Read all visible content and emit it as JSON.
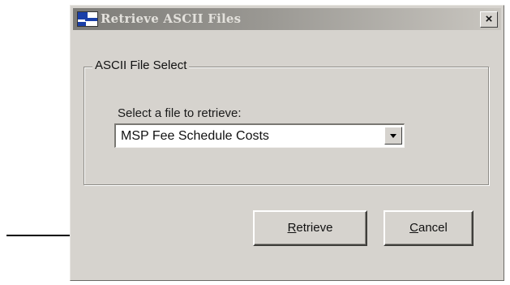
{
  "window": {
    "title": "Retrieve ASCII Files",
    "close_glyph": "×"
  },
  "group": {
    "legend": "ASCII File Select",
    "prompt": "Select a file to retrieve:"
  },
  "file_select": {
    "value": "MSP Fee Schedule Costs"
  },
  "buttons": {
    "retrieve_mnemonic": "R",
    "retrieve_rest": "etrieve",
    "cancel_mnemonic": "C",
    "cancel_rest": "ancel"
  },
  "icons": {
    "window": "app-window-icon",
    "close": "close-icon",
    "dropdown": "chevron-down-icon",
    "pointer": "arrow-right-icon"
  }
}
